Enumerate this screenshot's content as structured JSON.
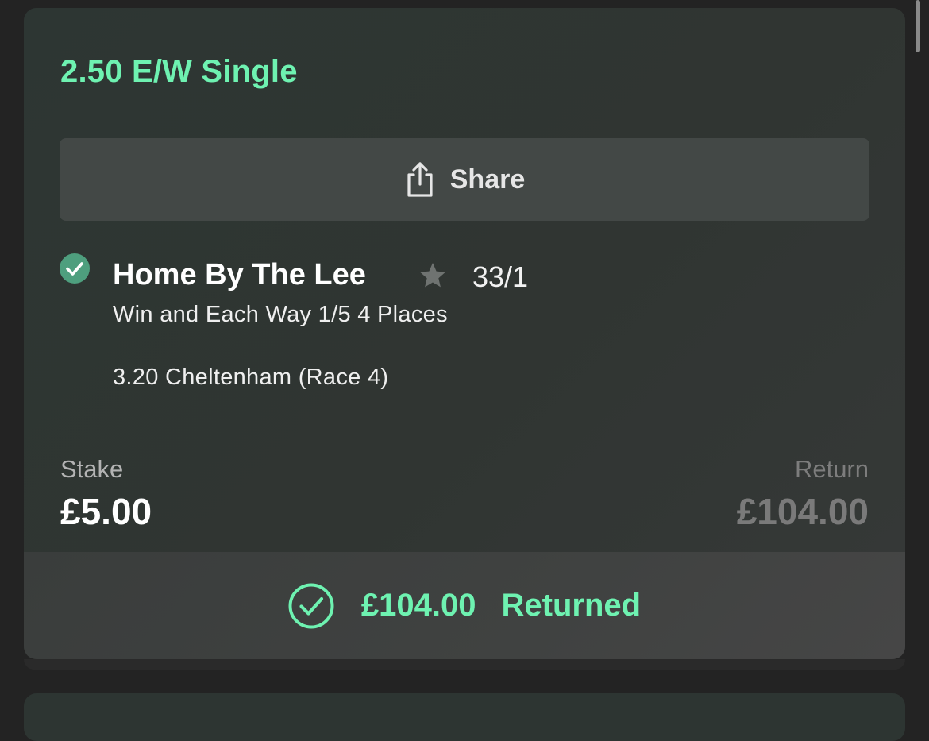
{
  "bet": {
    "title": "2.50 E/W Single",
    "share_label": "Share",
    "selection": {
      "name": "Home By The Lee",
      "odds": "33/1",
      "market": "Win and Each Way 1/5 4 Places",
      "event": "3.20 Cheltenham (Race 4)",
      "status_icon": "check-circle-icon",
      "favourite_icon": "star-icon"
    },
    "stake": {
      "label": "Stake",
      "value": "£5.00"
    },
    "return": {
      "label": "Return",
      "value": "£104.00"
    },
    "result": {
      "amount": "£104.00",
      "text": "Returned",
      "icon": "check-circle-outline-icon"
    }
  },
  "colors": {
    "accent_green": "#6ef2b1",
    "check_green": "#4e9f7e",
    "background": "#232323"
  }
}
